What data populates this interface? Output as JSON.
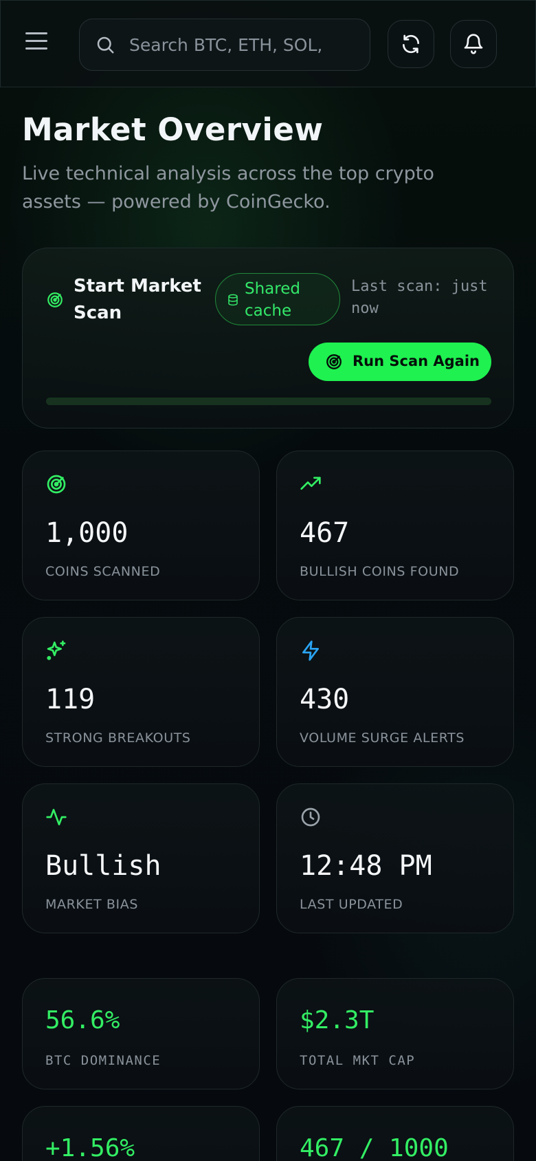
{
  "header": {
    "search": {
      "placeholder": "Search BTC, ETH, SOL,"
    },
    "icons": [
      "menu-icon",
      "search-icon",
      "refresh-icon",
      "bell-icon"
    ]
  },
  "page": {
    "title": "Market Overview",
    "subtitle": "Live technical analysis across the top crypto assets — powered by CoinGecko."
  },
  "scan": {
    "title": "Start Market Scan",
    "cache_label": "Shared cache",
    "last_scan": "Last scan: just now",
    "run_button": "Run Scan Again",
    "progress": 0
  },
  "stats": [
    {
      "icon": "radar-icon",
      "value": "1,000",
      "label": "COINS SCANNED"
    },
    {
      "icon": "trending-up-icon",
      "value": "467",
      "label": "BULLISH COINS FOUND"
    },
    {
      "icon": "sparkles-icon",
      "value": "119",
      "label": "STRONG BREAKOUTS"
    },
    {
      "icon": "zap-icon",
      "value": "430",
      "label": "VOLUME SURGE ALERTS"
    },
    {
      "icon": "activity-icon",
      "value": "Bullish",
      "label": "MARKET BIAS"
    },
    {
      "icon": "clock-icon",
      "value": "12:48 PM",
      "label": "LAST UPDATED"
    }
  ],
  "metrics": [
    {
      "value": "56.6%",
      "label": "BTC DOMINANCE"
    },
    {
      "value": "$2.3T",
      "label": "TOTAL MKT CAP"
    },
    {
      "value": "+1.56%",
      "label": ""
    },
    {
      "value": "467 / 1000",
      "label": ""
    }
  ],
  "colors": {
    "accent": "#1ff150",
    "accent_text": "#33ee64",
    "zap_blue": "#2aa4f4",
    "muted": "#8a939b",
    "background": "#060a0f"
  }
}
